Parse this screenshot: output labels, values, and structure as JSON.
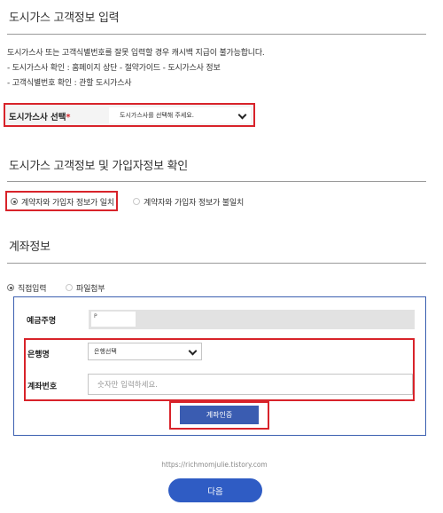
{
  "section1": {
    "title": "도시가스 고객정보 입력",
    "notice": [
      "도시가스사 또는 고객식별번호를 잘못 입력할 경우 캐시백 지급이 불가능합니다.",
      "- 도시가스사 확인 : 홈페이지 상단 - 절약가이드 - 도시가스사 정보",
      "- 고객식별번호 확인 : 관할 도시가스사"
    ],
    "gas_label": "도시가스사 선택",
    "required_mark": "*",
    "gas_select_value": "도시가스사를 선택해 주세요."
  },
  "section2": {
    "title": "도시가스 고객정보 및 가입자정보 확인",
    "options": [
      {
        "label": "계약자와 가입자 정보가 일치",
        "selected": true
      },
      {
        "label": "계약자와 가입자 정보가 불일치",
        "selected": false
      }
    ]
  },
  "section3": {
    "title": "계좌정보",
    "methods": [
      {
        "label": "직접입력",
        "selected": true
      },
      {
        "label": "파일첨부",
        "selected": false
      }
    ],
    "depositor_label": "예금주명",
    "depositor_value": "P",
    "bank_label": "은행명",
    "bank_select_value": "은행선택",
    "account_label": "계좌번호",
    "account_placeholder": "숫자만 입력하세요.",
    "auth_button": "계좌인증"
  },
  "watermark": "https://richmomjulie.tistory.com",
  "next_button": "다음",
  "colors": {
    "highlight": "#d8232a",
    "primary": "#2f5cc4",
    "panel_border": "#3b5fb0"
  }
}
